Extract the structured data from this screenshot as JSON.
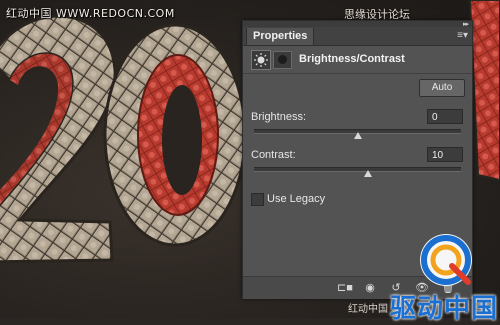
{
  "watermarks": {
    "top_left": "红动中国 WWW.REDOCN.COM",
    "top_right": "思缘设计论坛",
    "bottom_brand": "驱动中国",
    "bottom_small": "红动中国"
  },
  "panel": {
    "tab_label": "Properties",
    "title": "Brightness/Contrast",
    "auto_button": "Auto",
    "brightness": {
      "label": "Brightness:",
      "value": "0",
      "slider_fraction": 0.5
    },
    "contrast": {
      "label": "Contrast:",
      "value": "10",
      "slider_fraction": 0.55
    },
    "use_legacy": {
      "label": "Use Legacy",
      "checked": false
    }
  },
  "colors": {
    "panel_bg": "#535353",
    "accent_red": "#d8493c",
    "brand_blue": "#1a6fd0"
  }
}
